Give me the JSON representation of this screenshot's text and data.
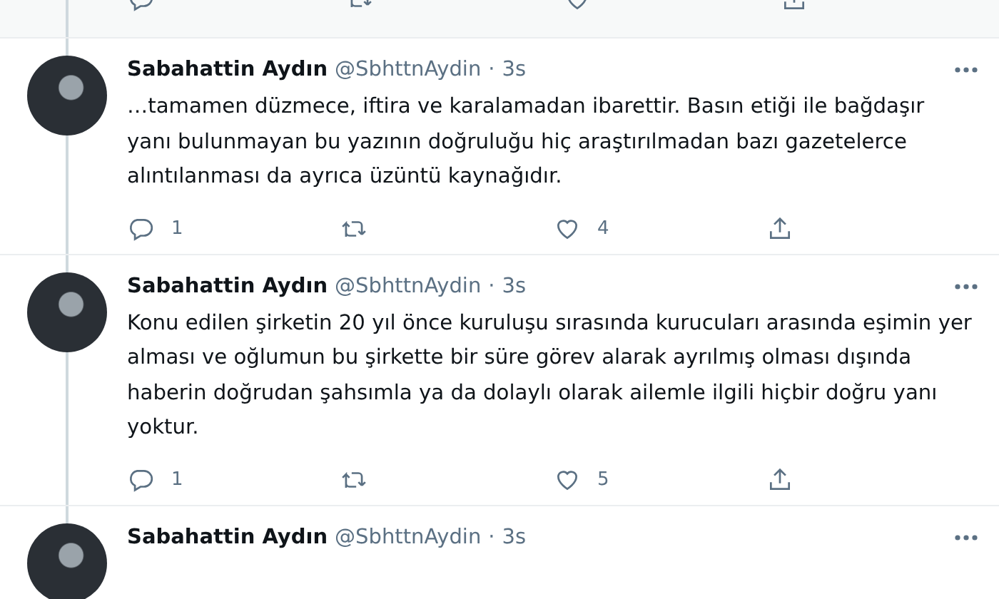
{
  "tweets": [
    {
      "name": "Sabahattin Aydın",
      "handle": "@SbhttnAydin",
      "separator": "·",
      "time": "3s",
      "text": "…tamamen düzmece, iftira ve karalamadan ibarettir. Basın etiği ile bağdaşır yanı bulunmayan bu yazının doğruluğu hiç araştırılmadan bazı gazetelerce alıntılanması da ayrıca üzüntü kaynağıdır.",
      "reply_count": "1",
      "like_count": "4"
    },
    {
      "name": "Sabahattin Aydın",
      "handle": "@SbhttnAydin",
      "separator": "·",
      "time": "3s",
      "text": "Konu edilen şirketin 20 yıl önce kuruluşu sırasında kurucuları arasında eşimin yer alması ve oğlumun bu şirkette bir süre görev alarak ayrılmış olması dışında haberin doğrudan şahsımla ya da dolaylı olarak ailemle ilgili hiçbir doğru yanı yoktur.",
      "reply_count": "1",
      "like_count": "5"
    },
    {
      "name": "Sabahattin Aydın",
      "handle": "@SbhttnAydin",
      "separator": "·",
      "time": "3s"
    }
  ]
}
